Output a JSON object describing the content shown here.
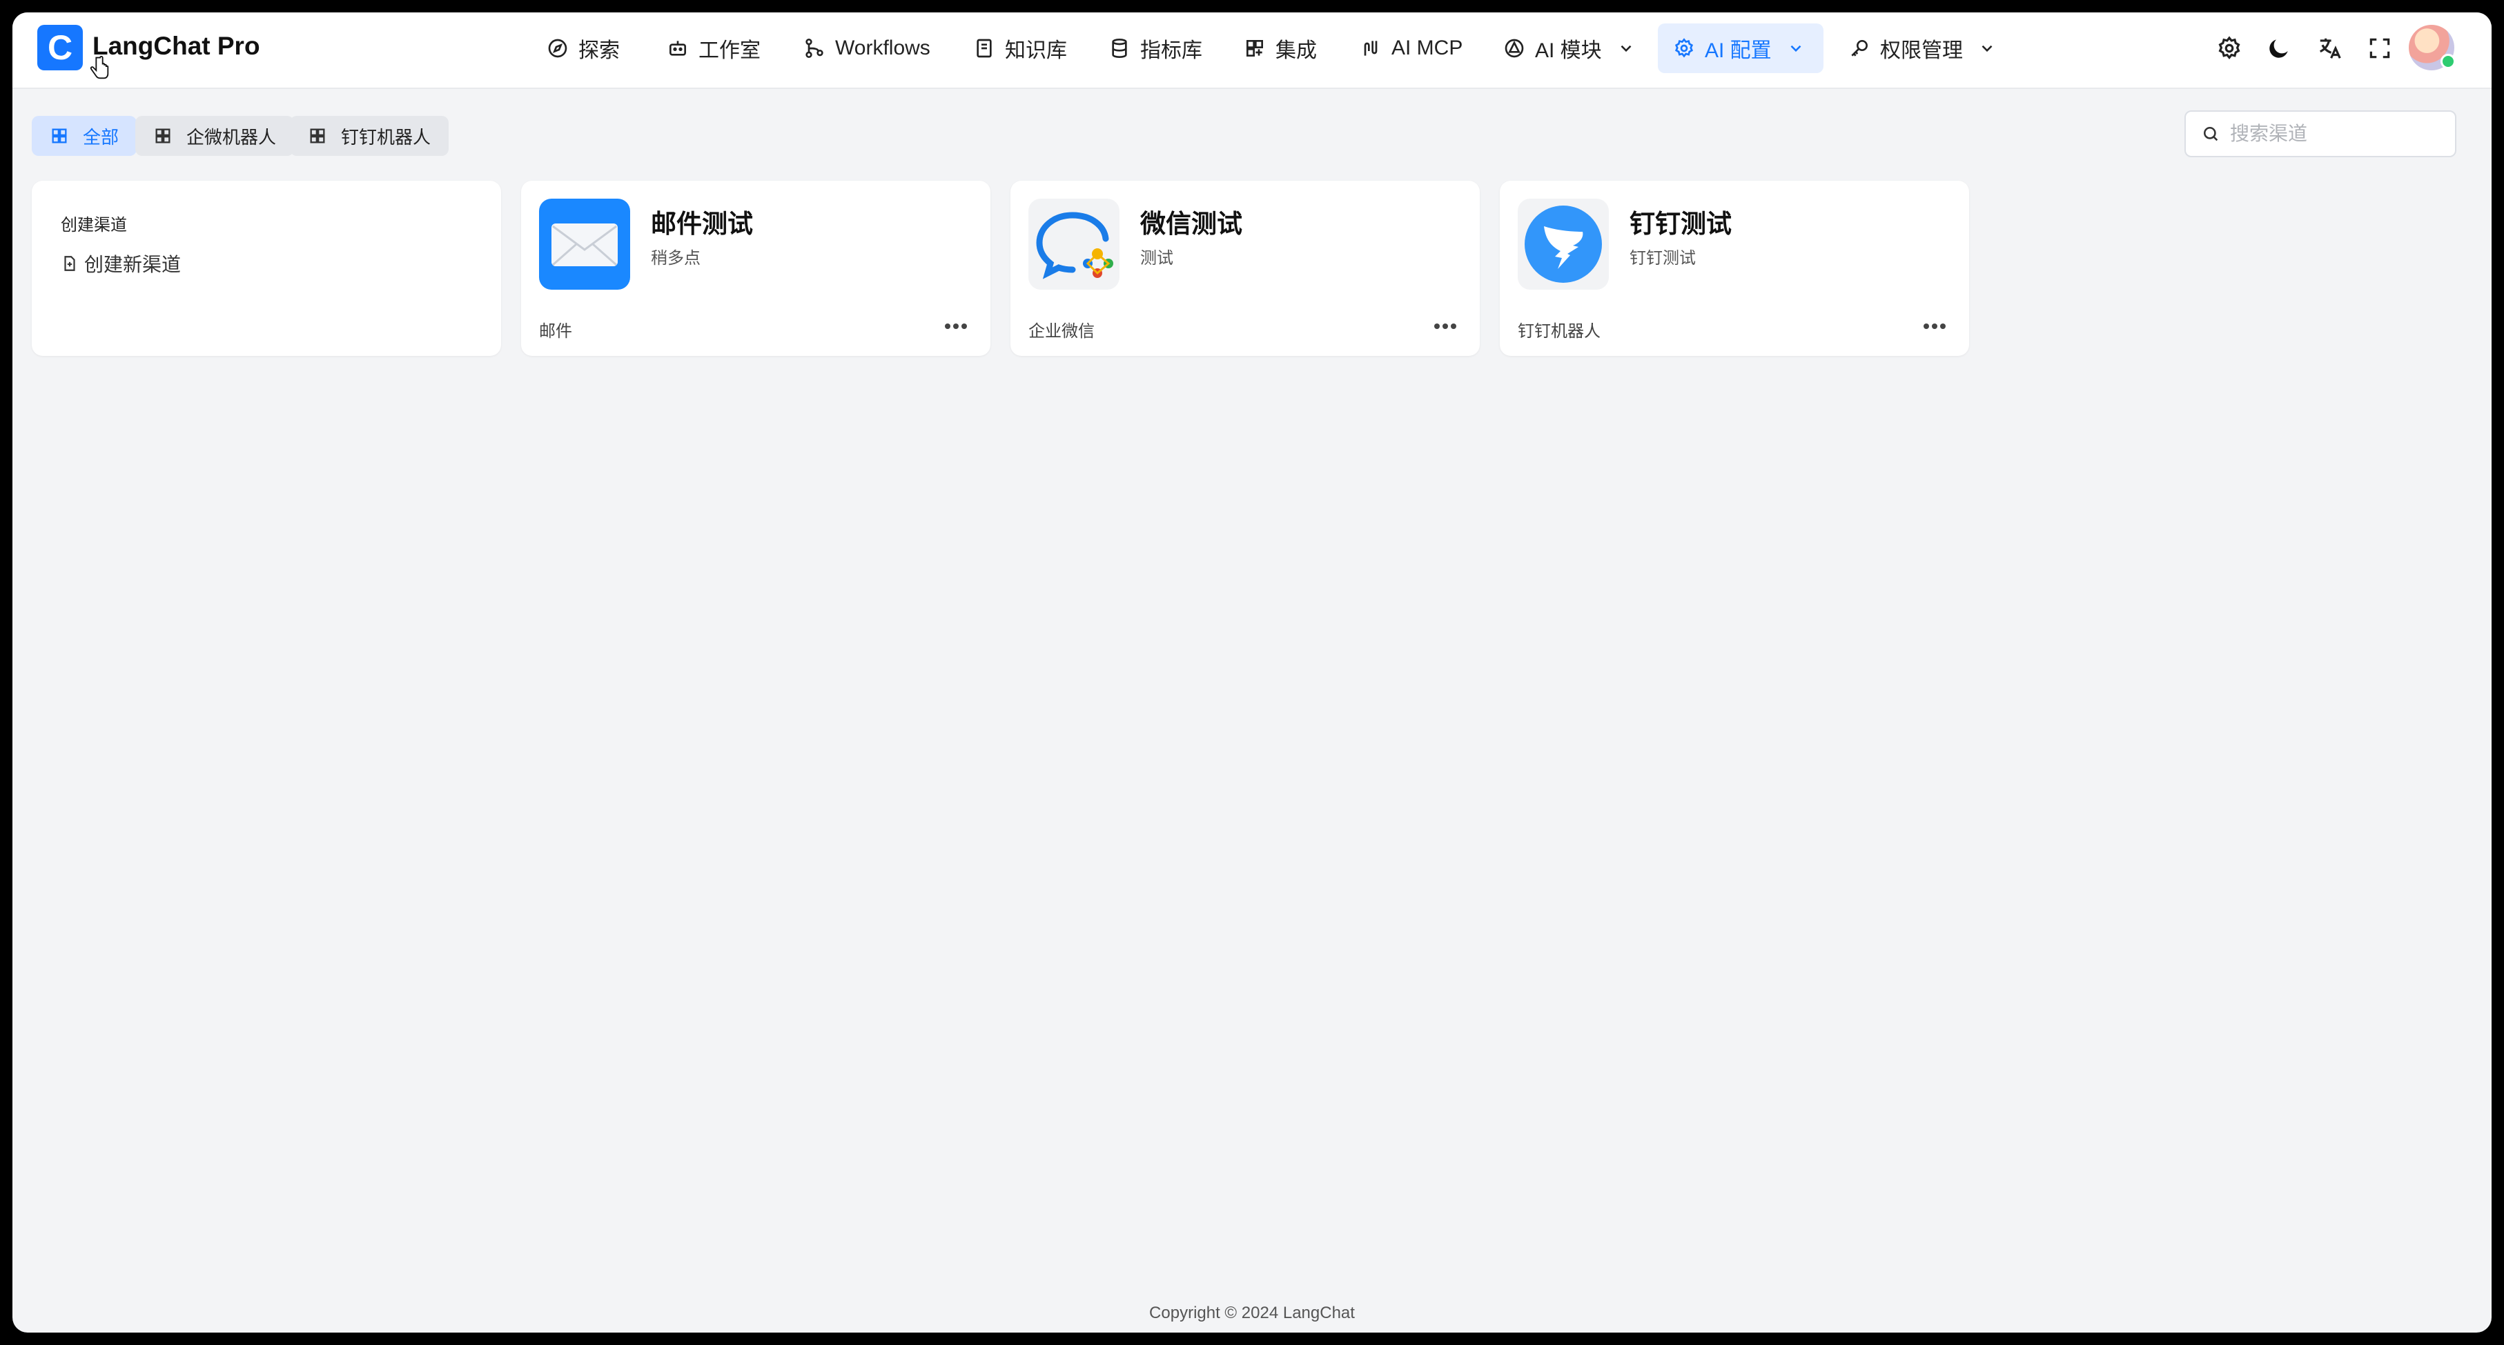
{
  "app": {
    "logo_letter": "C",
    "title": "LangChat Pro"
  },
  "nav": [
    {
      "label": "探索",
      "icon": "compass-icon"
    },
    {
      "label": "工作室",
      "icon": "robot-icon"
    },
    {
      "label": "Workflows",
      "icon": "workflow-icon"
    },
    {
      "label": "知识库",
      "icon": "book-icon"
    },
    {
      "label": "指标库",
      "icon": "database-icon"
    },
    {
      "label": "集成",
      "icon": "grid-plus-icon"
    },
    {
      "label": "AI MCP",
      "icon": "mcp-icon"
    },
    {
      "label": "AI 模块",
      "icon": "module-icon",
      "dropdown": true
    },
    {
      "label": "AI 配置",
      "icon": "gear-icon",
      "dropdown": true,
      "active": true
    },
    {
      "label": "权限管理",
      "icon": "key-icon",
      "dropdown": true
    }
  ],
  "tools": [
    "settings-icon",
    "dark-mode-icon",
    "translate-icon",
    "fullscreen-icon"
  ],
  "filters": [
    {
      "label": "全部",
      "active": true
    },
    {
      "label": "企微机器人",
      "active": false
    },
    {
      "label": "钉钉机器人",
      "active": false
    }
  ],
  "search": {
    "placeholder": "搜索渠道"
  },
  "create_card": {
    "title": "创建渠道",
    "link": "创建新渠道"
  },
  "channels": [
    {
      "name": "邮件测试",
      "desc": "稍多点",
      "type": "邮件",
      "icon": "mail-icon"
    },
    {
      "name": "微信测试",
      "desc": "测试",
      "type": "企业微信",
      "icon": "wecom-icon"
    },
    {
      "name": "钉钉测试",
      "desc": "钉钉测试",
      "type": "钉钉机器人",
      "icon": "dingtalk-icon"
    }
  ],
  "footer": {
    "copyright": "Copyright © 2024 LangChat"
  },
  "colors": {
    "accent": "#1677ff",
    "active_bg": "#e6efff",
    "page_bg": "#f3f4f6"
  }
}
